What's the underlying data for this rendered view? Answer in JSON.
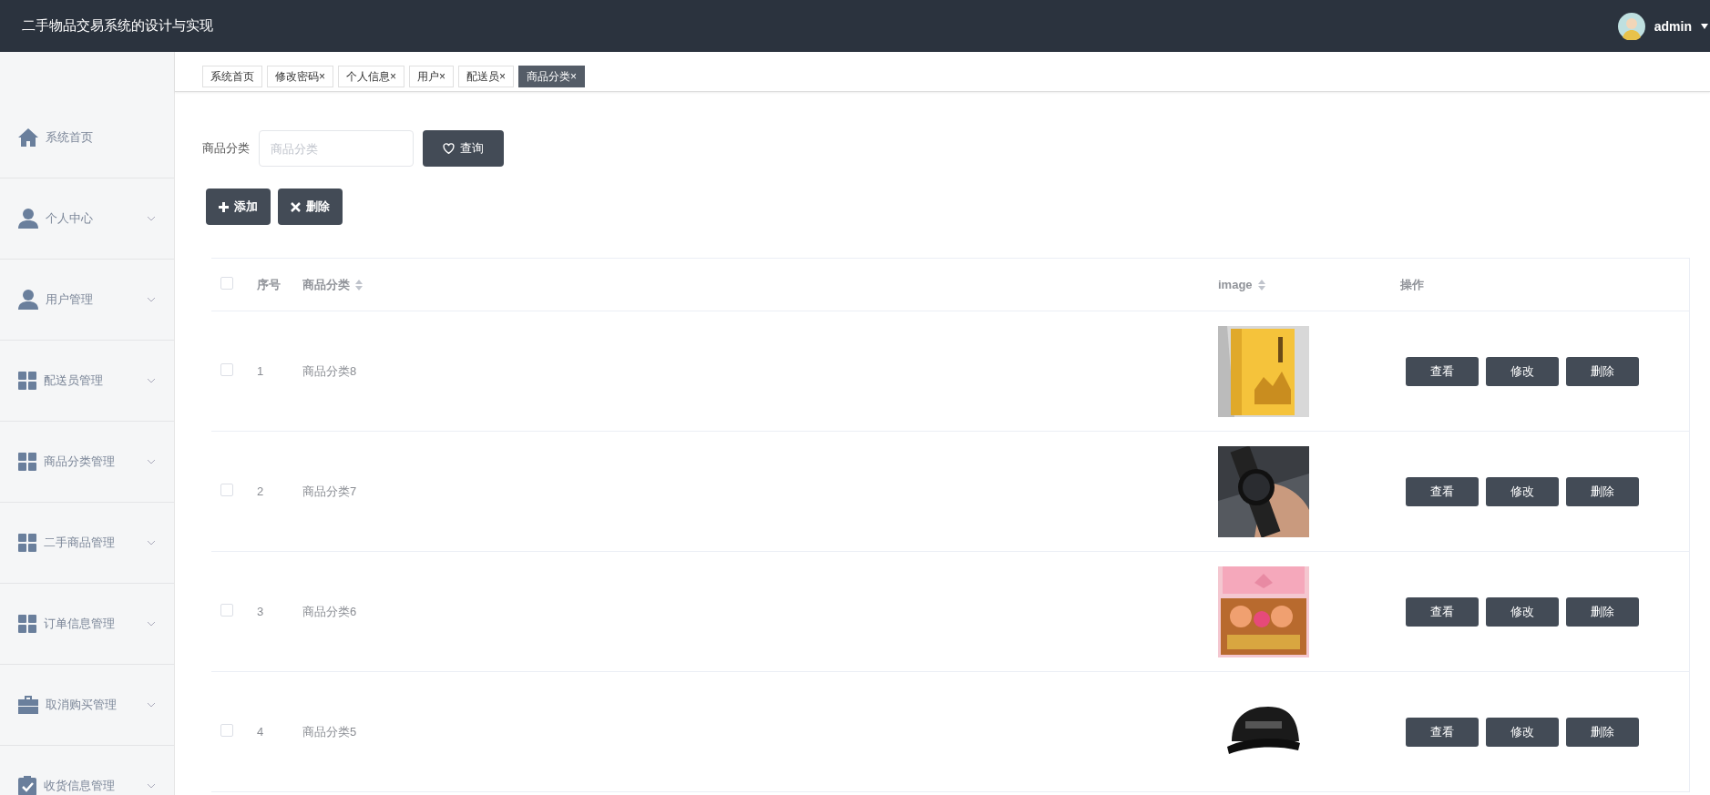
{
  "header": {
    "title": "二手物品交易系统的设计与实现",
    "user": "admin"
  },
  "sidebar": {
    "items": [
      {
        "label": "系统首页",
        "kind": "home",
        "expandable": false
      },
      {
        "label": "个人中心",
        "kind": "user",
        "expandable": true
      },
      {
        "label": "用户管理",
        "kind": "user",
        "expandable": true
      },
      {
        "label": "配送员管理",
        "kind": "grid",
        "expandable": true
      },
      {
        "label": "商品分类管理",
        "kind": "grid",
        "expandable": true
      },
      {
        "label": "二手商品管理",
        "kind": "grid",
        "expandable": true
      },
      {
        "label": "订单信息管理",
        "kind": "grid",
        "expandable": true
      },
      {
        "label": "取消购买管理",
        "kind": "briefcase",
        "expandable": true
      },
      {
        "label": "收货信息管理",
        "kind": "clipboard",
        "expandable": true
      }
    ]
  },
  "tabs": [
    {
      "label": "系统首页",
      "selected": false
    },
    {
      "label": "修改密码",
      "close": "×",
      "selected": false
    },
    {
      "label": "个人信息",
      "close": "×",
      "selected": false
    },
    {
      "label": "用户",
      "close": "×",
      "selected": false
    },
    {
      "label": "配送员",
      "close": "×",
      "selected": false
    },
    {
      "label": "商品分类",
      "close": "×",
      "selected": true
    }
  ],
  "search": {
    "label": "商品分类",
    "placeholder": "商品分类",
    "button": "查询"
  },
  "actions": [
    {
      "label": "添加",
      "kind": "add"
    },
    {
      "label": "删除",
      "kind": "delete"
    }
  ],
  "table": {
    "columns": [
      {
        "label": "序号",
        "sortable": false
      },
      {
        "label": "商品分类",
        "sortable": true
      },
      {
        "label": "image",
        "sortable": true
      },
      {
        "label": "操作",
        "sortable": false
      }
    ],
    "header_checked": false,
    "rows": [
      {
        "index": "1",
        "category": "商品分类8",
        "checked": false,
        "image": {
          "kind": "picture"
        },
        "buttons": [
          "查看",
          "修改",
          "删除"
        ]
      },
      {
        "index": "2",
        "category": "商品分类7",
        "checked": false,
        "image": {
          "kind": "picture"
        },
        "buttons": [
          "查看",
          "修改",
          "删除"
        ]
      },
      {
        "index": "3",
        "category": "商品分类6",
        "checked": false,
        "image": {
          "kind": "picture"
        },
        "buttons": [
          "查看",
          "修改",
          "删除"
        ]
      },
      {
        "index": "4",
        "category": "商品分类5",
        "checked": false,
        "image": {
          "kind": "picture"
        },
        "buttons": [
          "查看",
          "修改",
          "删除"
        ]
      }
    ]
  }
}
